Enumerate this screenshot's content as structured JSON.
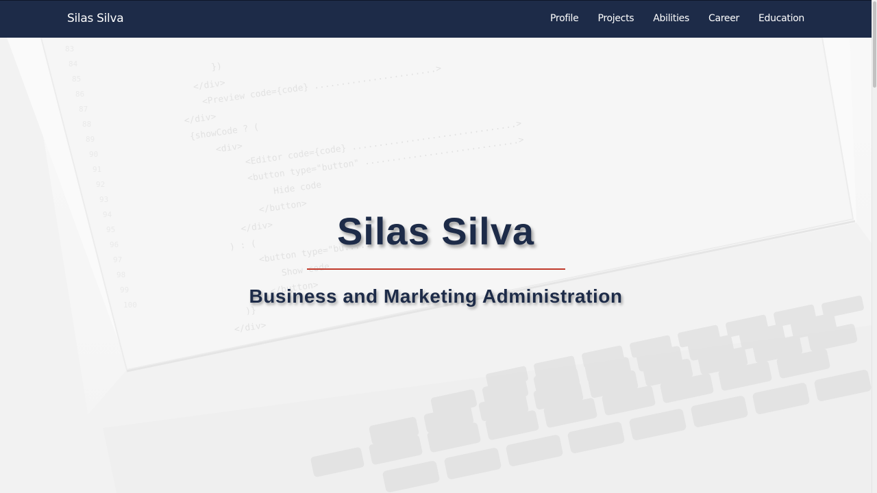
{
  "navbar": {
    "brand": "Silas Silva",
    "links": [
      {
        "label": "Profile"
      },
      {
        "label": "Projects"
      },
      {
        "label": "Abilities"
      },
      {
        "label": "Career"
      },
      {
        "label": "Education"
      }
    ]
  },
  "hero": {
    "title": "Silas Silva",
    "subtitle": "Business and Marketing Administration",
    "background_image": "laptop-with-code-photo",
    "colors": {
      "primary": "#1d2b48",
      "accent": "#c0392b"
    }
  }
}
